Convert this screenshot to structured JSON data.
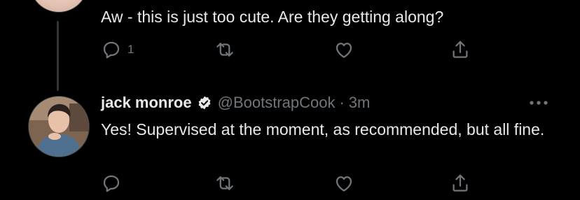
{
  "reply_tweet": {
    "text": "Aw - this is just too cute. Are they getting along?",
    "reply_count": "1",
    "icons": [
      "reply-icon",
      "retweet-icon",
      "like-icon",
      "share-icon"
    ]
  },
  "main_tweet": {
    "author_name": "jack monroe",
    "handle": "@BootstrapCook",
    "separator": "·",
    "time": "3m",
    "text": "Yes! Supervised at the moment, as recommended, but all fine.",
    "verified": true,
    "icons": [
      "more-icon",
      "reply-icon",
      "retweet-icon",
      "like-icon",
      "share-icon"
    ]
  },
  "colors": {
    "background": "#000000",
    "text": "#e7e9ea",
    "secondary": "#71767b",
    "thread_line": "#333639"
  }
}
